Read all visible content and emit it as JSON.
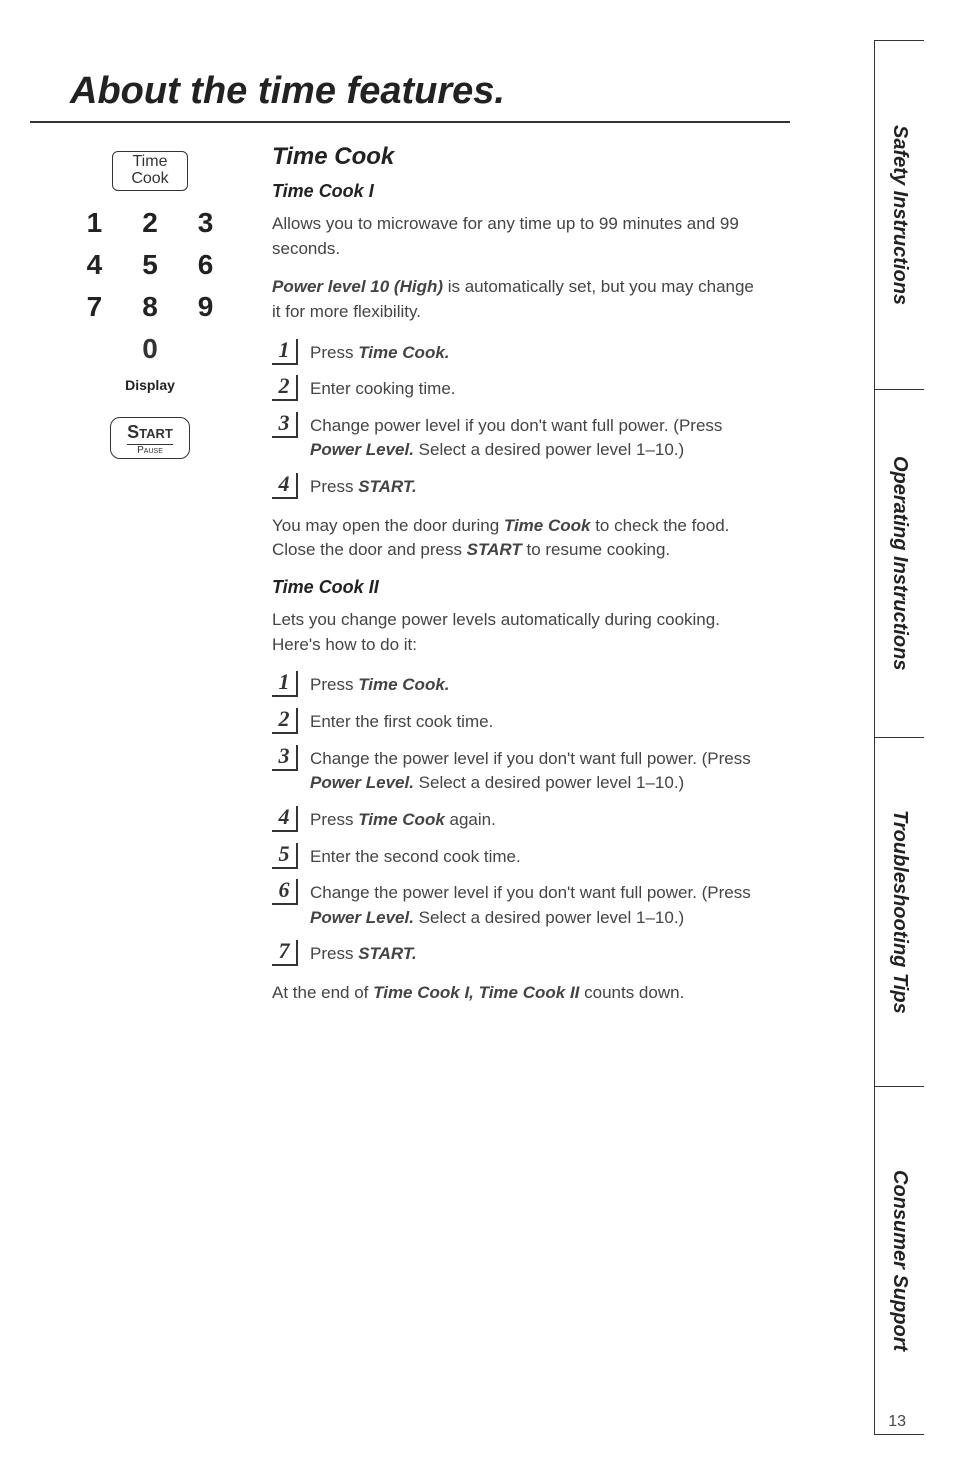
{
  "page_title": "About the time features.",
  "keypad": {
    "time_cook_label_top": "Time",
    "time_cook_label_bot": "Cook",
    "rows": [
      [
        "1",
        "2",
        "3"
      ],
      [
        "4",
        "5",
        "6"
      ],
      [
        "7",
        "8",
        "9"
      ]
    ],
    "zero": "0",
    "display_label": "Display",
    "start_top": "Start",
    "start_bot": "Pause"
  },
  "section": {
    "heading": "Time Cook",
    "tc1": {
      "heading": "Time Cook I",
      "p1": "Allows you to microwave for any time up to 99 minutes and 99 seconds.",
      "p2_prefix": "Power level 10 (High)",
      "p2_rest": " is automatically set, but you may change it for more flexibility.",
      "steps": [
        {
          "n": "1",
          "pre": "Press ",
          "bold": "Time Cook.",
          "post": ""
        },
        {
          "n": "2",
          "pre": "Enter cooking time.",
          "bold": "",
          "post": ""
        },
        {
          "n": "3",
          "pre": "Change power level if you don't want full power. (Press ",
          "bold": "Power Level.",
          "post": " Select a desired power level 1–10.)"
        },
        {
          "n": "4",
          "pre": "Press ",
          "bold": "START.",
          "post": ""
        }
      ],
      "closing_a": "You may open the door during ",
      "closing_b": "Time Cook",
      "closing_c": " to check the food. Close the door and press ",
      "closing_d": "START",
      "closing_e": " to resume cooking."
    },
    "tc2": {
      "heading": "Time Cook II",
      "p1": "Lets you change power levels automatically during cooking. Here's how to do it:",
      "steps": [
        {
          "n": "1",
          "pre": "Press ",
          "bold": "Time Cook.",
          "post": ""
        },
        {
          "n": "2",
          "pre": "Enter the first cook time.",
          "bold": "",
          "post": ""
        },
        {
          "n": "3",
          "pre": "Change the power level if you don't want full power. (Press ",
          "bold": "Power Level.",
          "post": " Select a desired power level 1–10.)"
        },
        {
          "n": "4",
          "pre": "Press ",
          "bold": "Time Cook",
          "post": " again."
        },
        {
          "n": "5",
          "pre": "Enter the second cook time.",
          "bold": "",
          "post": ""
        },
        {
          "n": "6",
          "pre": "Change the power level if you don't want full power. (Press ",
          "bold": "Power Level.",
          "post": " Select a desired power level 1–10.)"
        },
        {
          "n": "7",
          "pre": "Press ",
          "bold": "START.",
          "post": ""
        }
      ],
      "closing_a": "At the end of ",
      "closing_b": "Time Cook I, Time Cook II",
      "closing_c": " counts down."
    }
  },
  "tabs": [
    "Safety Instructions",
    "Operating Instructions",
    "Troubleshooting Tips",
    "Consumer Support"
  ],
  "page_number": "13"
}
